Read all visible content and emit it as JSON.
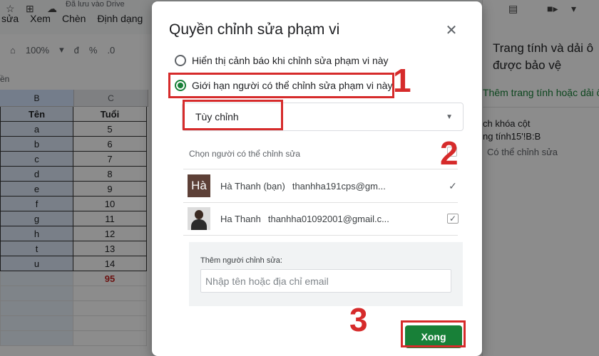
{
  "sheets": {
    "drive_status": "Đã lưu vào Drive",
    "menu": [
      "sửa",
      "Xem",
      "Chèn",
      "Định dạng"
    ],
    "toolbar": {
      "zoom": "100%",
      "currency": "đ",
      "percent": "%",
      "decimal": ".0"
    },
    "name_box": "ền",
    "columns": [
      "B",
      "C"
    ],
    "header_row": {
      "name": "Tên",
      "age": "Tuổi"
    },
    "rows": [
      {
        "name": "a",
        "age": "5"
      },
      {
        "name": "b",
        "age": "6"
      },
      {
        "name": "c",
        "age": "7"
      },
      {
        "name": "d",
        "age": "8"
      },
      {
        "name": "e",
        "age": "9"
      },
      {
        "name": "f",
        "age": "10"
      },
      {
        "name": "g",
        "age": "11"
      },
      {
        "name": "h",
        "age": "12"
      },
      {
        "name": "t",
        "age": "13"
      },
      {
        "name": "u",
        "age": "14"
      }
    ],
    "total": "95"
  },
  "side_panel": {
    "title": "Trang tính và dải ô được bảo vệ",
    "add_link": "Thêm trang tính hoặc dải ô",
    "range_desc_1": "ch khóa cột",
    "range_desc_2": "ng tính15'!B:B",
    "range_desc_3": "Có thể chỉnh sửa"
  },
  "dialog": {
    "title": "Quyền chỉnh sửa phạm vi",
    "close_icon": "close-icon",
    "option_warn": "Hiển thị cảnh báo khi chỉnh sửa phạm vi này",
    "option_restrict": "Giới hạn người có thể chỉnh sửa phạm vi này",
    "selected_option": "restrict",
    "dropdown_value": "Tùy chỉnh",
    "choose_label": "Chọn người có thể chỉnh sửa",
    "users": [
      {
        "avatar": "Hà",
        "name": "Hà Thanh (bạn)",
        "email": "thanhha191cps@gm...",
        "checked": true
      },
      {
        "avatar": "",
        "name": "Ha Thanh",
        "email": "thanhha01092001@gmail.c...",
        "checked": true
      }
    ],
    "add_editor_label": "Thêm người chỉnh sửa:",
    "add_editor_placeholder": "Nhập tên hoặc địa chỉ email",
    "done_label": "Xong"
  },
  "annotations": {
    "step1": "1",
    "step2": "2",
    "step3": "3",
    "color": "#d62b2b"
  },
  "colors": {
    "accent_green": "#188038"
  }
}
